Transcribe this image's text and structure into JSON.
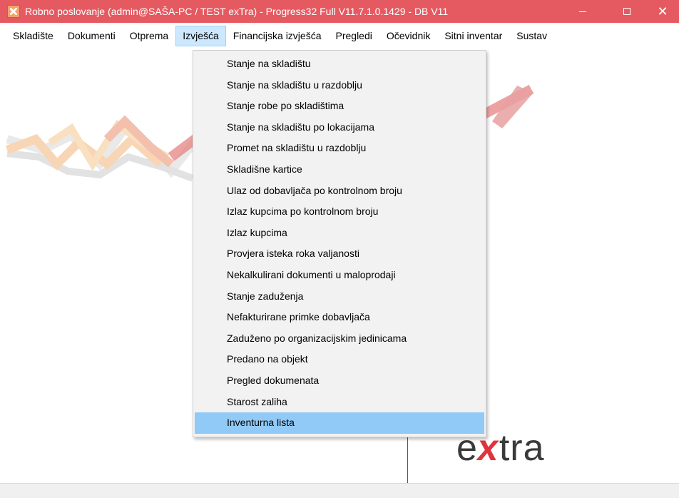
{
  "window": {
    "title": "Robno poslovanje (admin@SAŠA-PC / TEST exTra) - Progress32 Full V11.7.1.0.1429 - DB V11",
    "app_icon": "extra-app-icon",
    "title_bar_color": "#e55a61",
    "controls": {
      "minimize": "minimize-icon",
      "maximize": "maximize-icon",
      "close_glyph": "✕"
    }
  },
  "menubar": {
    "items": [
      {
        "label": "Skladište"
      },
      {
        "label": "Dokumenti"
      },
      {
        "label": "Otprema"
      },
      {
        "label": "Izvješća",
        "active": true
      },
      {
        "label": "Financijska izvješća"
      },
      {
        "label": "Pregledi"
      },
      {
        "label": "Očevidnik"
      },
      {
        "label": "Sitni inventar"
      },
      {
        "label": "Sustav"
      }
    ]
  },
  "dropdown": {
    "items": [
      {
        "label": "Stanje na skladištu"
      },
      {
        "label": "Stanje na skladištu u razdoblju"
      },
      {
        "label": "Stanje robe po skladištima"
      },
      {
        "label": "Stanje na skladištu po lokacijama"
      },
      {
        "label": "Promet na skladištu u razdoblju"
      },
      {
        "label": "Skladišne kartice"
      },
      {
        "label": "Ulaz od dobavljača po kontrolnom broju"
      },
      {
        "label": "Izlaz kupcima po kontrolnom broju"
      },
      {
        "label": "Izlaz kupcima"
      },
      {
        "label": "Provjera isteka roka valjanosti"
      },
      {
        "label": "Nekalkulirani dokumenti u maloprodaji"
      },
      {
        "label": "Stanje zaduženja"
      },
      {
        "label": "Nefakturirane primke dobavljača"
      },
      {
        "label": "Zaduženo po organizacijskim jedinicama"
      },
      {
        "label": "Predano na objekt"
      },
      {
        "label": "Pregled dokumenata"
      },
      {
        "label": "Starost zaliha"
      },
      {
        "label": "Inventurna lista",
        "selected": true
      }
    ],
    "selected_color": "#91c9f7"
  },
  "logo": {
    "prefix": "e",
    "x": "x",
    "suffix": "tra",
    "accent": "#e0343c"
  }
}
